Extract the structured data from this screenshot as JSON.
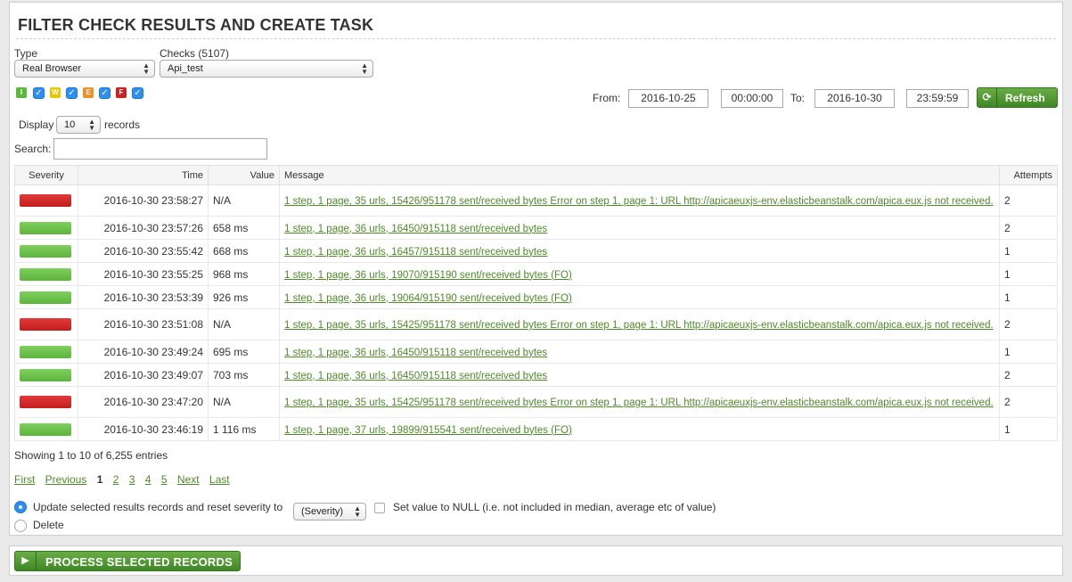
{
  "page": {
    "title": "FILTER CHECK RESULTS AND CREATE TASK"
  },
  "filters": {
    "type_label": "Type",
    "type_value": "Real Browser",
    "checks_label": "Checks (5107)",
    "checks_value": "Api_test",
    "severities": [
      {
        "letter": "I",
        "color": "#5cb83d",
        "checked": true
      },
      {
        "letter": "W",
        "color": "#e5c600",
        "checked": true
      },
      {
        "letter": "E",
        "color": "#f0902a",
        "checked": true
      },
      {
        "letter": "F",
        "color": "#cc2222",
        "checked": true
      }
    ],
    "from_label": "From:",
    "from_date": "2016-10-25",
    "from_time": "00:00:00",
    "to_label": "To:",
    "to_date": "2016-10-30",
    "to_time": "23:59:59",
    "refresh_label": "Refresh",
    "display_label": "Display",
    "display_value": "10",
    "records_label": "records",
    "search_label": "Search:",
    "search_value": ""
  },
  "table": {
    "columns": [
      "Severity",
      "Time",
      "Value",
      "Message",
      "Attempts"
    ],
    "rows": [
      {
        "severity": "red",
        "time": "2016-10-30 23:58:27",
        "value": "N/A",
        "message": "1 step, 1 page, 35 urls, 15426/951178 sent/received bytes Error on step 1, page 1: URL http://apicaeuxjs-env.elasticbeanstalk.com/apica.eux.js not received.",
        "attempts": "2"
      },
      {
        "severity": "green",
        "time": "2016-10-30 23:57:26",
        "value": "658 ms",
        "message": "1 step, 1 page, 36 urls, 16450/915118 sent/received bytes",
        "attempts": "2"
      },
      {
        "severity": "green",
        "time": "2016-10-30 23:55:42",
        "value": "668 ms",
        "message": "1 step, 1 page, 36 urls, 16457/915118 sent/received bytes",
        "attempts": "1"
      },
      {
        "severity": "green",
        "time": "2016-10-30 23:55:25",
        "value": "968 ms",
        "message": "1 step, 1 page, 36 urls, 19070/915190 sent/received bytes (FO)",
        "attempts": "1"
      },
      {
        "severity": "green",
        "time": "2016-10-30 23:53:39",
        "value": "926 ms",
        "message": "1 step, 1 page, 36 urls, 19064/915190 sent/received bytes (FO)",
        "attempts": "1"
      },
      {
        "severity": "red",
        "time": "2016-10-30 23:51:08",
        "value": "N/A",
        "message": "1 step, 1 page, 35 urls, 15425/951178 sent/received bytes Error on step 1, page 1: URL http://apicaeuxjs-env.elasticbeanstalk.com/apica.eux.js not received.",
        "attempts": "2"
      },
      {
        "severity": "green",
        "time": "2016-10-30 23:49:24",
        "value": "695 ms",
        "message": "1 step, 1 page, 36 urls, 16450/915118 sent/received bytes",
        "attempts": "1"
      },
      {
        "severity": "green",
        "time": "2016-10-30 23:49:07",
        "value": "703 ms",
        "message": "1 step, 1 page, 36 urls, 16450/915118 sent/received bytes",
        "attempts": "2"
      },
      {
        "severity": "red",
        "time": "2016-10-30 23:47:20",
        "value": "N/A",
        "message": "1 step, 1 page, 35 urls, 15425/951178 sent/received bytes Error on step 1, page 1: URL http://apicaeuxjs-env.elasticbeanstalk.com/apica.eux.js not received.",
        "attempts": "2"
      },
      {
        "severity": "green",
        "time": "2016-10-30 23:46:19",
        "value": "1 116 ms",
        "message": "1 step, 1 page, 37 urls, 19899/915541 sent/received bytes (FO)",
        "attempts": "1"
      }
    ]
  },
  "summary": {
    "showing": "Showing 1 to 10 of 6,255 entries"
  },
  "pager": {
    "first": "First",
    "previous": "Previous",
    "pages": [
      "1",
      "2",
      "3",
      "4",
      "5"
    ],
    "current": "1",
    "next": "Next",
    "last": "Last"
  },
  "actions": {
    "update_label": "Update selected results records and reset severity to",
    "severity_select": "(Severity)",
    "null_label": "Set value to NULL (i.e. not included in median, average etc of value)",
    "delete_label": "Delete",
    "process_label": "PROCESS SELECTED RECORDS"
  },
  "colors": {
    "accent_green": "#4f8a2b",
    "severity_red": "#d42a2a",
    "severity_green": "#6ec24b",
    "radio_blue": "#2d8ff2"
  }
}
